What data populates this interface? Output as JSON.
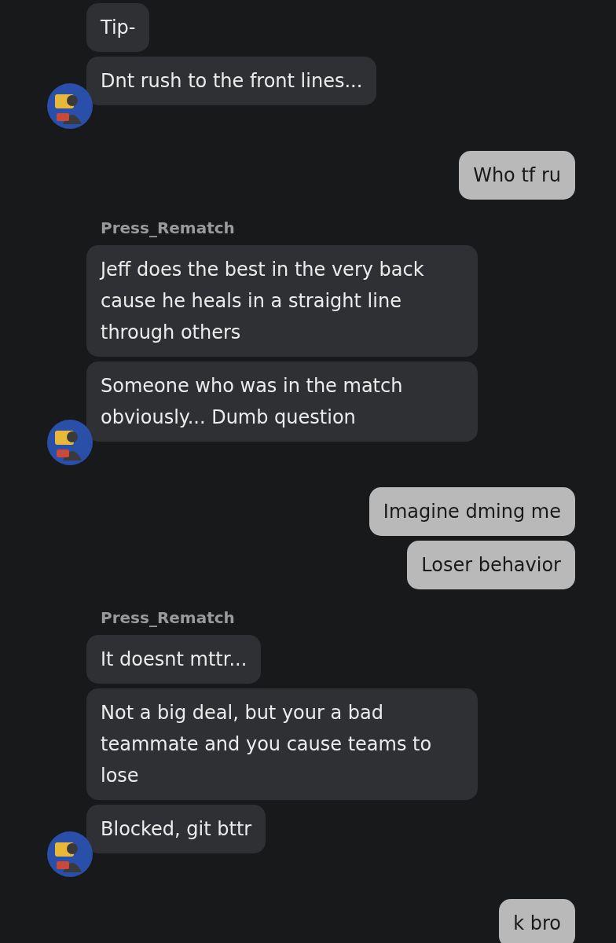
{
  "conversation": [
    {
      "kind": "received",
      "messages": [
        "Tip-",
        "Dnt rush to the front lines..."
      ]
    },
    {
      "kind": "sent",
      "messages": [
        "Who tf ru"
      ]
    },
    {
      "kind": "received",
      "sender": "Press_Rematch",
      "messages": [
        "Jeff does the best in the very back cause he heals in a straight line through others",
        "Someone who was in the match obviously... Dumb question"
      ]
    },
    {
      "kind": "sent",
      "messages": [
        "Imagine dming me",
        "Loser behavior"
      ]
    },
    {
      "kind": "received",
      "sender": "Press_Rematch",
      "messages": [
        "It doesnt mttr...",
        "Not a big deal, but your a bad teammate and you cause teams to lose",
        "Blocked, git bttr"
      ]
    },
    {
      "kind": "sent",
      "messages": [
        "k bro"
      ]
    }
  ]
}
